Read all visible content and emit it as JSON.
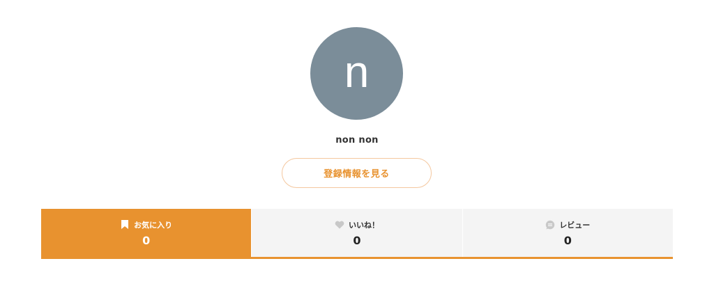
{
  "profile": {
    "avatar_initial": "n",
    "avatar_color": "#7b8d99",
    "username": "non non",
    "view_profile_label": "登録情報を見る"
  },
  "tabs": [
    {
      "icon": "bookmark-icon",
      "label": "お気に入り",
      "count": "0",
      "active": true
    },
    {
      "icon": "heart-icon",
      "label": "いいね！",
      "count": "0",
      "active": false
    },
    {
      "icon": "speech-bubble-icon",
      "label": "レビュー",
      "count": "0",
      "active": false
    }
  ],
  "colors": {
    "accent": "#e8922f",
    "tab_inactive_bg": "#f4f4f4",
    "button_border": "#f4c79e"
  }
}
